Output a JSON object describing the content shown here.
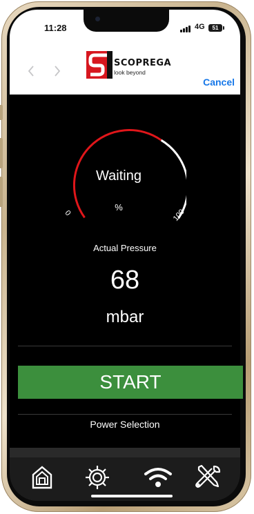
{
  "status_bar": {
    "time": "11:28",
    "network": "4G",
    "battery": "51"
  },
  "header": {
    "logo_name": "SCOPREGA",
    "logo_tagline": "look beyond",
    "back_icon": "chevron-left-icon",
    "forward_icon": "chevron-right-icon",
    "cancel_label": "Cancel"
  },
  "gauge": {
    "status": "Waiting",
    "unit": "%",
    "min_label": "0",
    "max_label": "100"
  },
  "pressure": {
    "label": "Actual Pressure",
    "value": "68",
    "unit": "mbar"
  },
  "start_label": "START",
  "power_selection_label": "Power Selection",
  "tabs": [
    {
      "icon": "home-icon"
    },
    {
      "icon": "gear-icon"
    },
    {
      "icon": "wifi-icon"
    },
    {
      "icon": "tools-icon"
    }
  ],
  "colors": {
    "accent_red": "#d7171f",
    "start_green": "#3c8f3d",
    "link_blue": "#1677e8",
    "gauge_red": "#e0161a"
  }
}
